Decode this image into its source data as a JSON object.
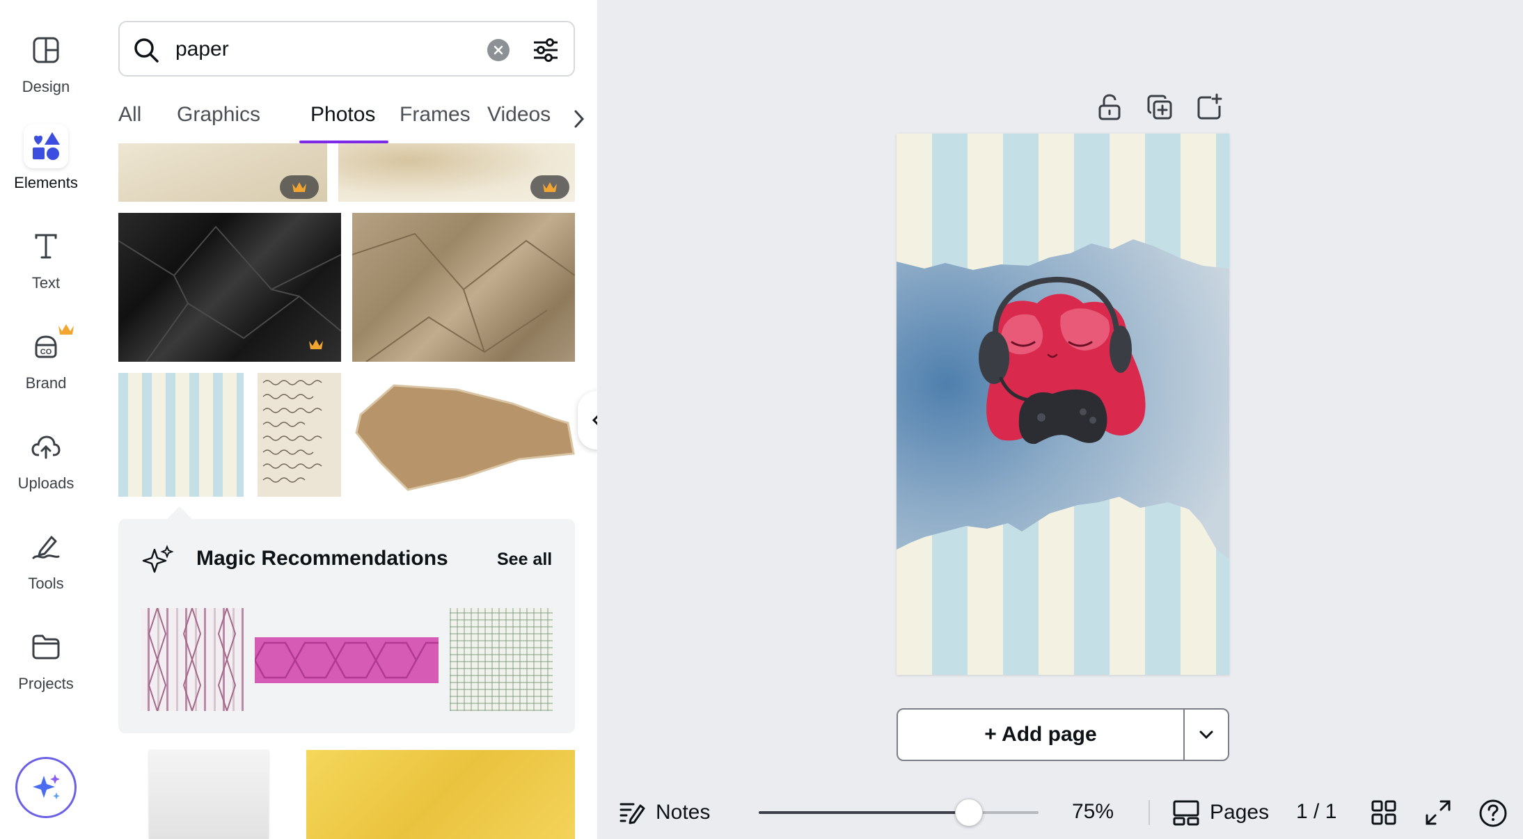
{
  "rail": {
    "items": [
      {
        "label": "Design",
        "icon": "design-icon"
      },
      {
        "label": "Elements",
        "icon": "elements-icon"
      },
      {
        "label": "Text",
        "icon": "text-icon"
      },
      {
        "label": "Brand",
        "icon": "brand-icon"
      },
      {
        "label": "Uploads",
        "icon": "uploads-icon"
      },
      {
        "label": "Tools",
        "icon": "tools-icon"
      },
      {
        "label": "Projects",
        "icon": "projects-icon"
      }
    ],
    "active": "Elements"
  },
  "search": {
    "value": "paper"
  },
  "tabs": [
    {
      "label": "All"
    },
    {
      "label": "Graphics"
    },
    {
      "label": "Photos"
    },
    {
      "label": "Frames"
    },
    {
      "label": "Videos"
    }
  ],
  "active_tab": "Photos",
  "recommendations": {
    "title": "Magic Recommendations",
    "see_all": "See all"
  },
  "canvas": {
    "add_page": "+ Add page"
  },
  "bottom_bar": {
    "notes": "Notes",
    "zoom": "75%",
    "zoom_fraction": 0.75,
    "pages": "Pages",
    "page_count": "1 / 1"
  },
  "colors": {
    "accent": "#7d2ae8",
    "canvas_bg": "#ebecf0",
    "stripe_blue": "#c5dfe6",
    "stripe_cream": "#f3f1e1"
  }
}
